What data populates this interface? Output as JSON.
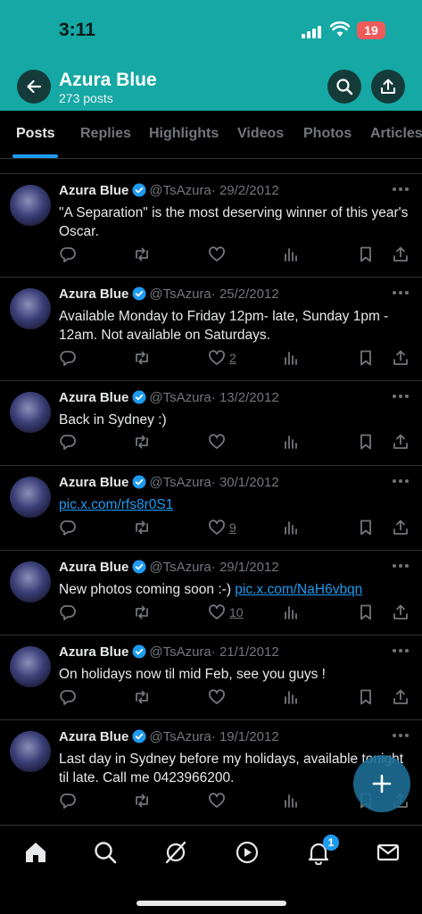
{
  "status_bar": {
    "time": "3:11",
    "battery": "19"
  },
  "header": {
    "profile_name": "Azura Blue",
    "post_count": "273 posts",
    "background_color": "#15a8a4"
  },
  "tabs": [
    {
      "label": "Posts",
      "active": true
    },
    {
      "label": "Replies"
    },
    {
      "label": "Highlights"
    },
    {
      "label": "Videos"
    },
    {
      "label": "Photos"
    },
    {
      "label": "Articles"
    }
  ],
  "posts": [
    {
      "name": "Azura Blue",
      "handle": "@TsAzura",
      "date": "· 29/2/2012",
      "text": "\"A Separation\" is the most deserving winner of this year's Oscar.",
      "likes": ""
    },
    {
      "name": "Azura Blue",
      "handle": "@TsAzura",
      "date": "· 25/2/2012",
      "text": "Available Monday to Friday 12pm- late, Sunday 1pm - 12am. Not available on Saturdays.",
      "likes": "2"
    },
    {
      "name": "Azura Blue",
      "handle": "@TsAzura",
      "date": "· 13/2/2012",
      "text": "Back in Sydney :)",
      "likes": ""
    },
    {
      "name": "Azura Blue",
      "handle": "@TsAzura",
      "date": "· 30/1/2012",
      "text": "",
      "link": "pic.x.com/rfs8r0S1",
      "likes": "9"
    },
    {
      "name": "Azura Blue",
      "handle": "@TsAzura",
      "date": "· 29/1/2012",
      "text": "New photos coming soon :-) ",
      "link": "pic.x.com/NaH6vbqn",
      "likes": "10"
    },
    {
      "name": "Azura Blue",
      "handle": "@TsAzura",
      "date": "· 21/1/2012",
      "text": "On holidays now til mid Feb, see you guys !",
      "likes": ""
    },
    {
      "name": "Azura Blue",
      "handle": "@TsAzura",
      "date": "· 19/1/2012",
      "text": "Last day in Sydney before my holidays, available tonight til late. Call me 0423966200.",
      "likes": ""
    }
  ],
  "bottom_nav": {
    "items": [
      "home-icon",
      "search-icon",
      "grok-icon",
      "video-icon",
      "notifications-icon",
      "messages-icon"
    ],
    "notification_badge": "1"
  },
  "colors": {
    "accent": "#1d9bf0",
    "muted": "#71767b"
  }
}
